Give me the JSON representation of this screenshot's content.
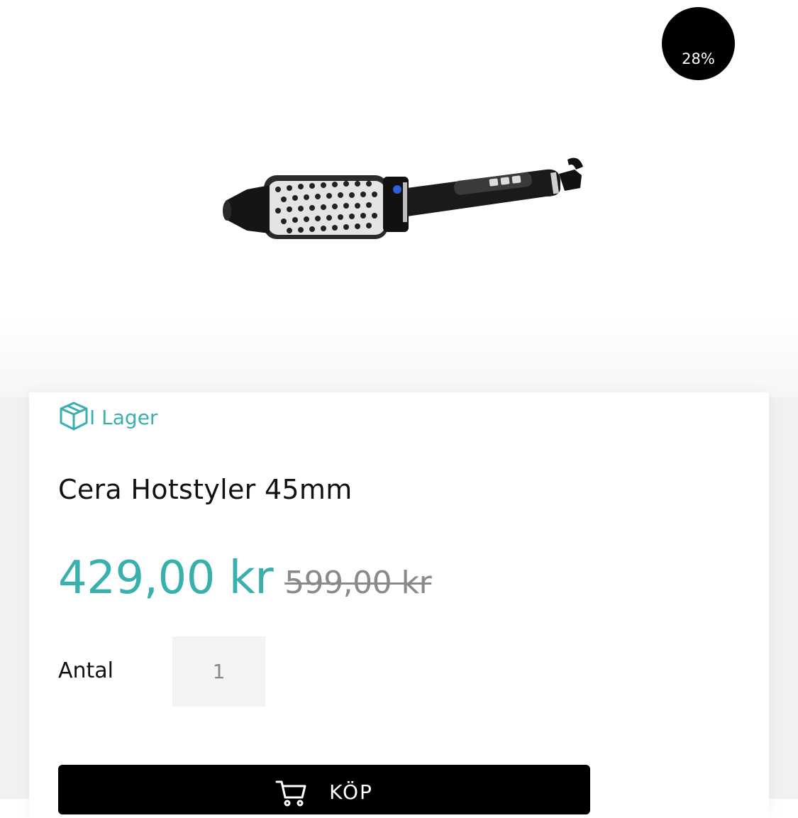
{
  "product": {
    "discount_badge": "28%",
    "image_alt": "hot air brush styler",
    "stock_status": "I Lager",
    "title": "Cera Hotstyler 45mm",
    "price_current": "429,00 kr",
    "price_old": "599,00 kr",
    "quantity_label": "Antal",
    "quantity_value": "1",
    "buy_label": "KÖP"
  },
  "icons": {
    "stock": "box-icon",
    "buy": "cart-icon"
  },
  "colors": {
    "accent": "#39b0ac",
    "badge_bg": "#000000",
    "button_bg": "#000000",
    "old_price": "#8a8a8a"
  }
}
